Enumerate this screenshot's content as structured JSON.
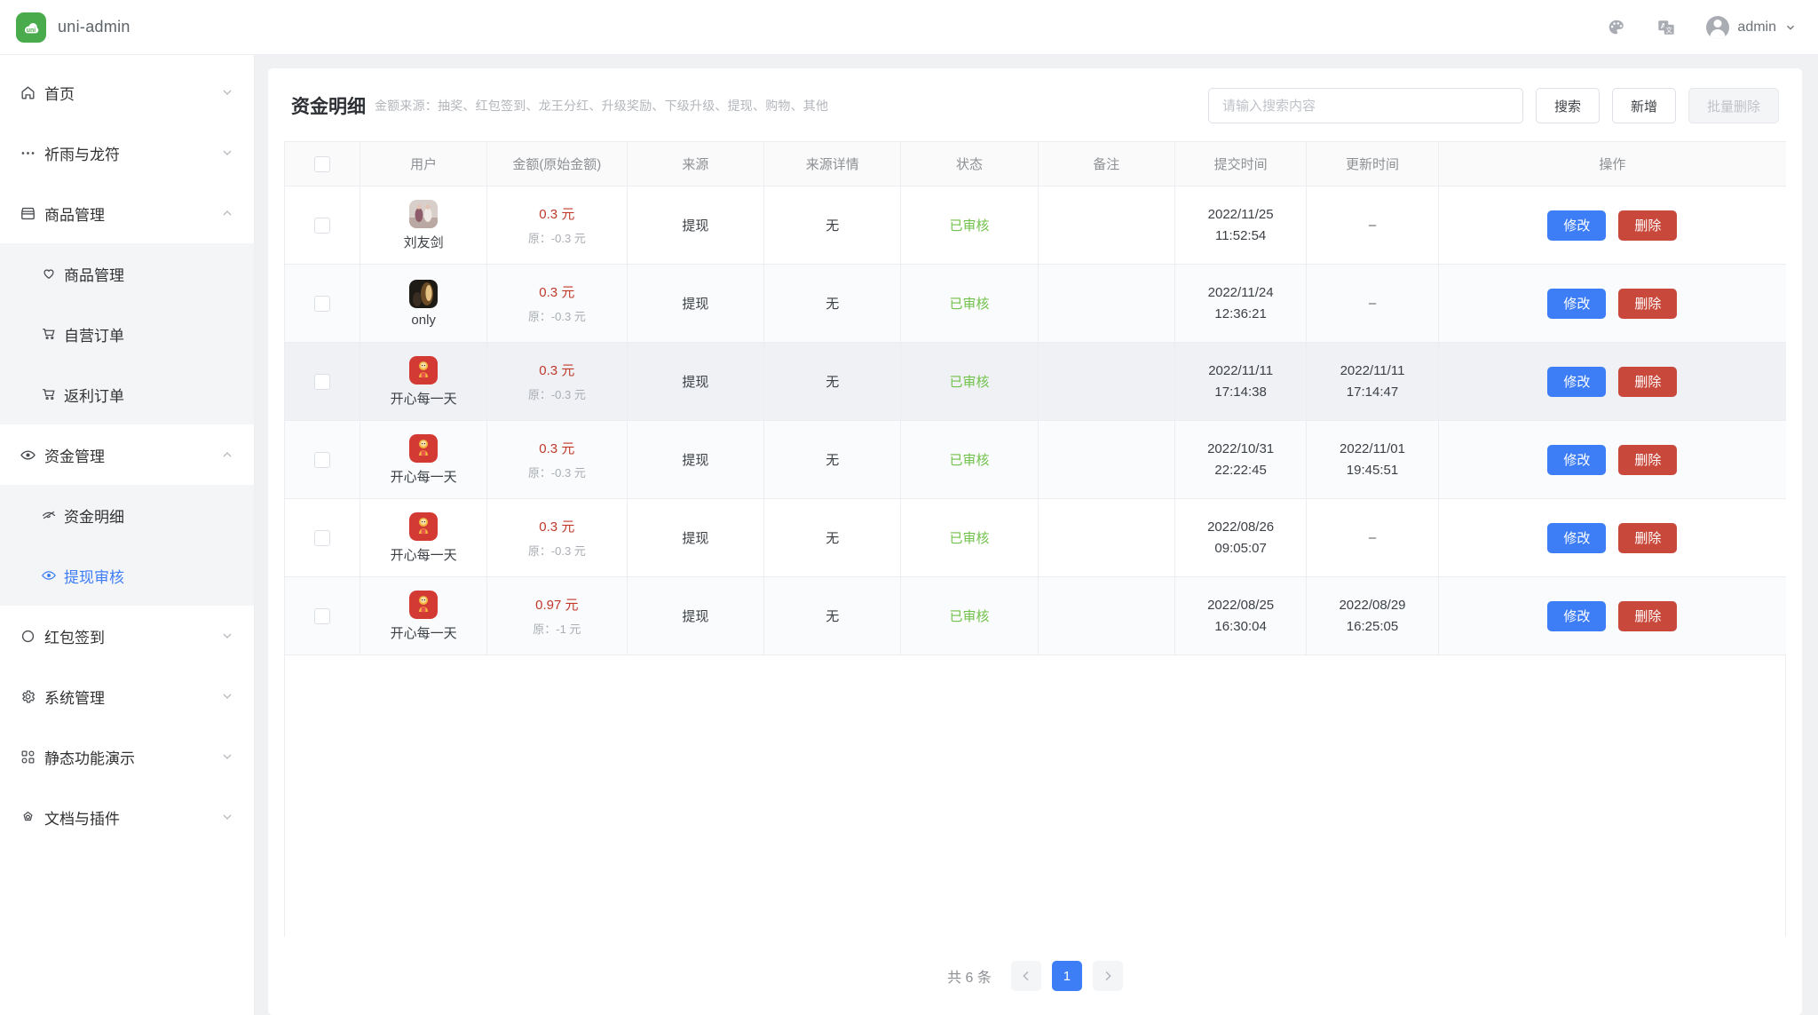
{
  "header": {
    "brand": "uni-admin",
    "logo_text": "uni",
    "logo_color": "#4aab4d",
    "theme_icon": "palette-icon",
    "language_icon": "translate-icon",
    "user_name": "admin"
  },
  "sidebar": {
    "items": [
      {
        "label": "首页",
        "icon": "home-icon",
        "arrow": "chevron-down",
        "expanded": false
      },
      {
        "label": "祈雨与龙符",
        "icon": "dots-icon",
        "arrow": "chevron-down",
        "expanded": false
      },
      {
        "label": "商品管理",
        "icon": "shop-icon",
        "arrow": "chevron-up",
        "expanded": true,
        "children": [
          {
            "label": "商品管理",
            "icon": "heart-icon",
            "active": false
          },
          {
            "label": "自营订单",
            "icon": "cart-icon",
            "active": false
          },
          {
            "label": "返利订单",
            "icon": "cart-icon",
            "active": false
          }
        ]
      },
      {
        "label": "资金管理",
        "icon": "eye-icon",
        "arrow": "chevron-up",
        "expanded": true,
        "children": [
          {
            "label": "资金明细",
            "icon": "eye-off-icon",
            "active": false
          },
          {
            "label": "提现审核",
            "icon": "eye-icon",
            "active": true
          }
        ]
      },
      {
        "label": "红包签到",
        "icon": "circle-icon",
        "arrow": "chevron-down",
        "expanded": false
      },
      {
        "label": "系统管理",
        "icon": "gear-icon",
        "arrow": "chevron-down",
        "expanded": false
      },
      {
        "label": "静态功能演示",
        "icon": "grid-icon",
        "arrow": "chevron-down",
        "expanded": false
      },
      {
        "label": "文档与插件",
        "icon": "cloud-icon",
        "arrow": "chevron-down",
        "expanded": false
      }
    ],
    "active_color": "#3f7df6"
  },
  "card": {
    "title": "资金明细",
    "subtitle": "金额来源：抽奖、红包签到、龙王分红、升级奖励、下级升级、提现、购物、其他",
    "search_placeholder": "请输入搜索内容",
    "search_value": "",
    "search_button": "搜索",
    "add_button": "新增",
    "batch_delete_button": "批量删除"
  },
  "table": {
    "columns": [
      "",
      "用户",
      "金额(原始金额)",
      "来源",
      "来源详情",
      "状态",
      "备注",
      "提交时间",
      "更新时间",
      "操作"
    ],
    "edit_label": "修改",
    "delete_label": "删除",
    "rows": [
      {
        "user": "刘友剑",
        "avatar": "photo-light",
        "amount": "0.3 元",
        "original": "原：-0.3 元",
        "source": "提现",
        "source_detail": "无",
        "status": "已审核",
        "remark": "",
        "submit_date": "2022/11/25",
        "submit_time": "11:52:54",
        "update_date": "–",
        "update_time": ""
      },
      {
        "user": "only",
        "avatar": "photo-dark",
        "amount": "0.3 元",
        "original": "原：-0.3 元",
        "source": "提现",
        "source_detail": "无",
        "status": "已审核",
        "remark": "",
        "submit_date": "2022/11/24",
        "submit_time": "12:36:21",
        "update_date": "–",
        "update_time": ""
      },
      {
        "user": "开心每一天",
        "avatar": "cartoon-red",
        "amount": "0.3 元",
        "original": "原：-0.3 元",
        "source": "提现",
        "source_detail": "无",
        "status": "已审核",
        "remark": "",
        "submit_date": "2022/11/11",
        "submit_time": "17:14:38",
        "update_date": "2022/11/11",
        "update_time": "17:14:47"
      },
      {
        "user": "开心每一天",
        "avatar": "cartoon-red",
        "amount": "0.3 元",
        "original": "原：-0.3 元",
        "source": "提现",
        "source_detail": "无",
        "status": "已审核",
        "remark": "",
        "submit_date": "2022/10/31",
        "submit_time": "22:22:45",
        "update_date": "2022/11/01",
        "update_time": "19:45:51"
      },
      {
        "user": "开心每一天",
        "avatar": "cartoon-red",
        "amount": "0.3 元",
        "original": "原：-0.3 元",
        "source": "提现",
        "source_detail": "无",
        "status": "已审核",
        "remark": "",
        "submit_date": "2022/08/26",
        "submit_time": "09:05:07",
        "update_date": "–",
        "update_time": ""
      },
      {
        "user": "开心每一天",
        "avatar": "cartoon-red",
        "amount": "0.97 元",
        "original": "原：-1 元",
        "source": "提现",
        "source_detail": "无",
        "status": "已审核",
        "remark": "",
        "submit_date": "2022/08/25",
        "submit_time": "16:30:04",
        "update_date": "2022/08/29",
        "update_time": "16:25:05"
      }
    ]
  },
  "pagination": {
    "total_label": "共 6 条",
    "prev_icon": "chevron-left-icon",
    "next_icon": "chevron-right-icon",
    "current_page": "1"
  },
  "colors": {
    "primary": "#3d7df6",
    "danger": "#c8483c",
    "amount": "#c0392b",
    "success": "#71c24b"
  }
}
